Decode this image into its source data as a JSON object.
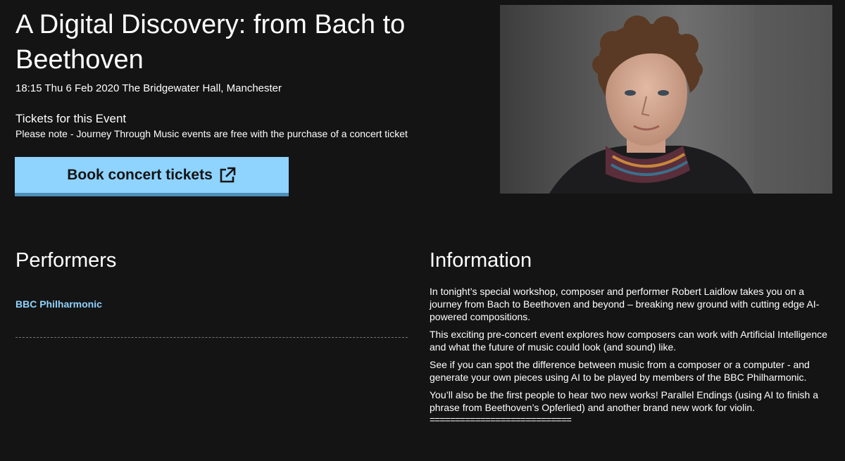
{
  "event": {
    "title": "A Digital Discovery: from Bach to Beethoven",
    "datetime_venue": "18:15 Thu 6 Feb 2020 The Bridgewater Hall, Manchester"
  },
  "tickets": {
    "heading": "Tickets for this Event",
    "note": "Please note - Journey Through Music events are free with the purchase of a concert ticket",
    "book_label": "Book concert tickets",
    "book_icon": "external-link-icon"
  },
  "photo": {
    "alt": "Portrait of Robert Laidlow"
  },
  "performers": {
    "heading": "Performers",
    "items": [
      {
        "name": "BBC Philharmonic"
      }
    ]
  },
  "information": {
    "heading": "Information",
    "paragraphs": [
      "In tonight’s special workshop, composer and performer Robert Laidlow takes you on a journey from Bach to Beethoven and beyond – breaking new ground with cutting edge AI-powered compositions.",
      "This exciting pre-concert event explores how composers can work with Artificial Intelligence and what the future of music could look (and sound) like.",
      "See if you can spot the difference between music from a composer or a computer - and generate your own pieces using AI to be played by members of the BBC Philharmonic.",
      "You’ll also be the first people to hear two new works! Parallel Endings (using AI to finish a phrase from Beethoven’s Opferlied) and another brand new work for violin."
    ],
    "separator": "============================"
  },
  "colors": {
    "background": "#141414",
    "accent": "#8fd3ff",
    "button_shadow": "#4d8fb8",
    "text": "#ffffff"
  }
}
